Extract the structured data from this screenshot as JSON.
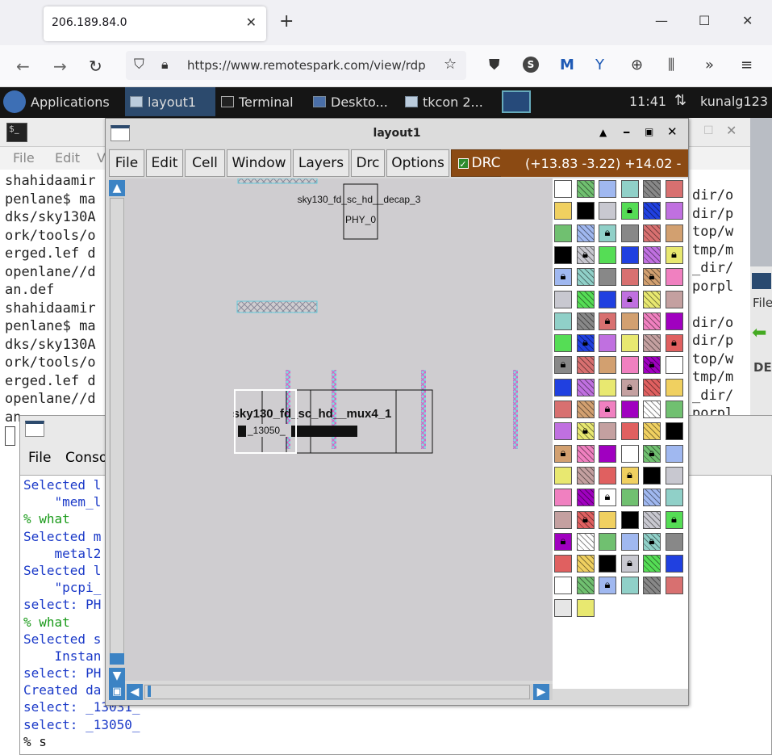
{
  "browser": {
    "tab_title": "206.189.84.0",
    "new_tab": "+",
    "url": "https://www.remotespark.com/view/rdp"
  },
  "panel": {
    "applications": "Applications",
    "items": [
      "layout1",
      "Terminal",
      "Deskto...",
      "tkcon 2..."
    ],
    "clock": "11:41",
    "user": "kunalg123"
  },
  "terminal": {
    "menu": [
      "File",
      "Edit",
      "V"
    ],
    "left_lines": [
      "shahidaamir",
      "penlane$ ma",
      "dks/sky130A",
      "ork/tools/o",
      "erged.lef d",
      "openlane//d",
      "an.def",
      "shahidaamir",
      "penlane$ ma",
      "dks/sky130A",
      "ork/tools/o",
      "erged.lef d",
      "openlane//d",
      "an"
    ],
    "right_lines": [
      "dir/o",
      "dir/p",
      "top/w",
      "tmp/m",
      "_dir/",
      "porpl",
      "",
      "dir/o",
      "dir/p",
      "top/w",
      "tmp/m",
      "_dir/",
      "porpl"
    ]
  },
  "right_window": {
    "menu": "File",
    "label": "DE"
  },
  "tkcon": {
    "menu": [
      "File",
      "Conso"
    ],
    "lines": [
      {
        "text": "Selected l",
        "color": "blue"
      },
      {
        "text": "    \"mem_l",
        "color": "blue"
      },
      {
        "text": "% what",
        "color": "green"
      },
      {
        "text": "Selected m",
        "color": "blue"
      },
      {
        "text": "    metal2",
        "color": "blue"
      },
      {
        "text": "Selected l",
        "color": "blue"
      },
      {
        "text": "    \"pcpi_",
        "color": "blue"
      },
      {
        "text": "select: PH",
        "color": "blue"
      },
      {
        "text": "% what",
        "color": "green"
      },
      {
        "text": "Selected s",
        "color": "blue"
      },
      {
        "text": "    Instan",
        "color": "blue"
      },
      {
        "text": "select: PH",
        "color": "blue"
      },
      {
        "text": "Created da",
        "color": "blue"
      },
      {
        "text": "select: _13031_",
        "color": "blue"
      },
      {
        "text": "select: _13050_",
        "color": "blue"
      },
      {
        "text": "% s",
        "color": "black"
      }
    ]
  },
  "layout_window": {
    "title": "layout1",
    "menu": [
      "File",
      "Edit",
      "Cell",
      "Window",
      "Layers",
      "Drc",
      "Options"
    ],
    "drc_label": "DRC",
    "coords": "(+13.83 -3.22) +14.02 -",
    "cell_name": "sky130_fd_sc_hd__decap_3",
    "instance_name": "PHY_0",
    "overlap_label": "sky130_fd_sc_hd__mux4_1",
    "instance_label": "_13050_"
  },
  "palette": {
    "rows": 19,
    "cols": 6,
    "colors": [
      "#ffffff",
      "#c8c8d0",
      "#d87070",
      "#c4a0a0",
      "#70c070",
      "#55dd55",
      "#d2a070",
      "#e06060",
      "#a0b8f0",
      "#2040e0",
      "#f080c0",
      "#f0d060",
      "#90d0c8",
      "#c070e0",
      "#a000c0",
      "#000000",
      "#888888",
      "#e8e870"
    ]
  }
}
